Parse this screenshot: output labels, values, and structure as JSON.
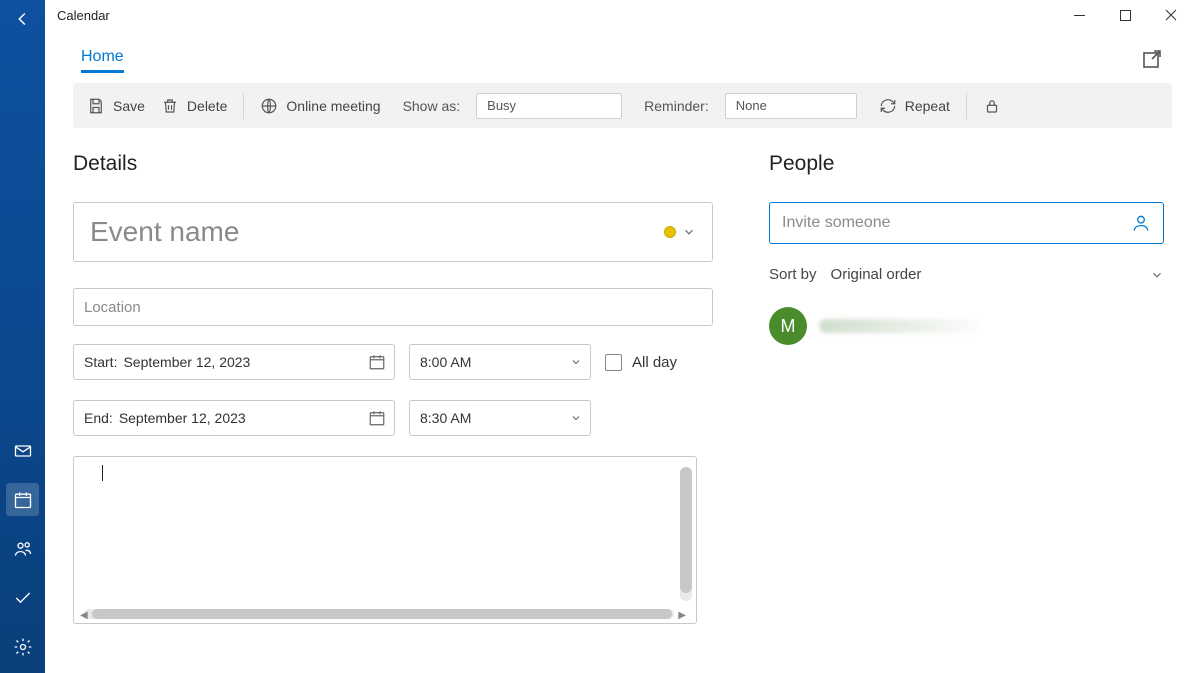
{
  "window": {
    "title": "Calendar"
  },
  "tabs": {
    "home": "Home"
  },
  "ribbon": {
    "save": "Save",
    "delete": "Delete",
    "online_meeting": "Online meeting",
    "show_as_label": "Show as:",
    "show_as_value": "Busy",
    "reminder_label": "Reminder:",
    "reminder_value": "None",
    "repeat": "Repeat"
  },
  "sections": {
    "details": "Details",
    "people": "People"
  },
  "event": {
    "name_placeholder": "Event name",
    "location_placeholder": "Location",
    "start_label": "Start:",
    "start_date": "September 12, 2023",
    "start_time": "8:00 AM",
    "end_label": "End:",
    "end_date": "September 12, 2023",
    "end_time": "8:30 AM",
    "all_day_label": "All day"
  },
  "people": {
    "invite_placeholder": "Invite someone",
    "sort_by_label": "Sort by",
    "sort_by_value": "Original order",
    "attendees": [
      {
        "initial": "M"
      }
    ]
  }
}
